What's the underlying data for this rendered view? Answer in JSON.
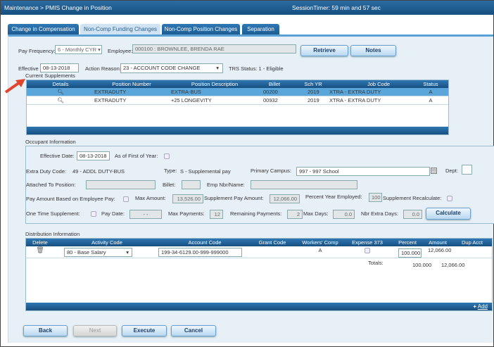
{
  "header": {
    "breadcrumb": "Maintenance > PMIS Change in Position",
    "session_timer": "SessionTimer: 59 min and 57 sec"
  },
  "tabs": [
    {
      "label": "Change in Compensation"
    },
    {
      "label": "Non-Comp Funding Changes",
      "active": true
    },
    {
      "label": "Non-Comp Position Changes"
    },
    {
      "label": "Separation"
    }
  ],
  "top": {
    "pay_frequency_label": "Pay Frequency:",
    "pay_frequency_value": "6 - Monthly CYR",
    "employee_label": "Employee:",
    "employee_value": "000100 : BROWNLEE, BRENDA RAE",
    "retrieve": "Retrieve",
    "notes": "Notes",
    "effective_dt_label": "Effective Dt:",
    "effective_dt_value": "08-13-2018",
    "action_reason_label": "Action Reason:",
    "action_reason_value": "23 - ACCOUNT CODE CHANGE",
    "trs_status": "TRS Status:  1 - Eligible"
  },
  "supplements": {
    "title": "Current Supplements",
    "columns": [
      "Details",
      "Position Number",
      "Position Description",
      "Billet",
      "Sch YR",
      "Job Code",
      "Status"
    ],
    "rows": [
      {
        "position_number": "EXTRADUTY",
        "description": "EXTRA-BUS",
        "billet": "00200",
        "sch_yr": "2019",
        "job_code": "XTRA - EXTRA DUTY",
        "status": "A",
        "selected": true
      },
      {
        "position_number": "EXTRADUTY",
        "description": "+25 LONGEVITY",
        "billet": "00932",
        "sch_yr": "2019",
        "job_code": "XTRA - EXTRA DUTY",
        "status": "A"
      }
    ]
  },
  "occupant": {
    "title": "Occupant Information",
    "effective_date_label": "Effective Date:",
    "effective_date": "08-13-2018",
    "first_of_year_label": "As of First of Year:",
    "extra_duty_label": "Extra Duty Code:",
    "extra_duty_value": "49 - ADDL DUTY-BUS",
    "type_label": "Type:",
    "type_value": "S - Supplemental pay",
    "primary_campus_label": "Primary Campus:",
    "primary_campus_value": "997 - 997 School",
    "dept_label": "Dept:",
    "attached_label": "Attached To Position:",
    "billet_label": "Billet:",
    "emp_label": "Emp Nbr/Name:",
    "pay_based_label": "Pay Amount Based on Employee Pay:",
    "max_amount_label": "Max Amount:",
    "max_amount": "13,526.00",
    "supp_pay_label": "Supplement Pay Amount:",
    "supp_pay": "12,066.00",
    "pct_year_label": "Percent Year Employed:",
    "pct_year": "100",
    "recalc_label": "Supplement Recalculate:",
    "one_time_label": "One Time Supplement:",
    "pay_date_label": "Pay Date:",
    "pay_date": "- -",
    "max_payments_label": "Max Payments:",
    "max_payments": "12",
    "remaining_label": "Remaining Payments:",
    "remaining": "2",
    "max_days_label": "Max Days:",
    "max_days": "0.0",
    "extra_days_label": "Nbr Extra Days:",
    "extra_days": "0.0",
    "calculate": "Calculate"
  },
  "distribution": {
    "title": "Distribution Information",
    "columns": [
      "Delete",
      "Activity Code",
      "Account Code",
      "Grant Code",
      "Workers' Comp",
      "Expense 373",
      "Percent",
      "Amount",
      "Dup Acct"
    ],
    "row": {
      "activity_code": "80 - Base Salary",
      "account_code": "199-34-6129.00-999-999000",
      "workers_comp": "A",
      "percent": "100.000",
      "amount": "12,066.00"
    },
    "totals_label": "Totals:",
    "total_percent": "100.000",
    "total_amount": "12,066.00",
    "add": "Add"
  },
  "footer": {
    "back": "Back",
    "next": "Next",
    "execute": "Execute",
    "cancel": "Cancel"
  },
  "colors": {
    "title_bar": "#1c5a8e",
    "selected_row": "#5aa6da",
    "panel": "#e7eff7",
    "arrow": "#e0462f"
  }
}
